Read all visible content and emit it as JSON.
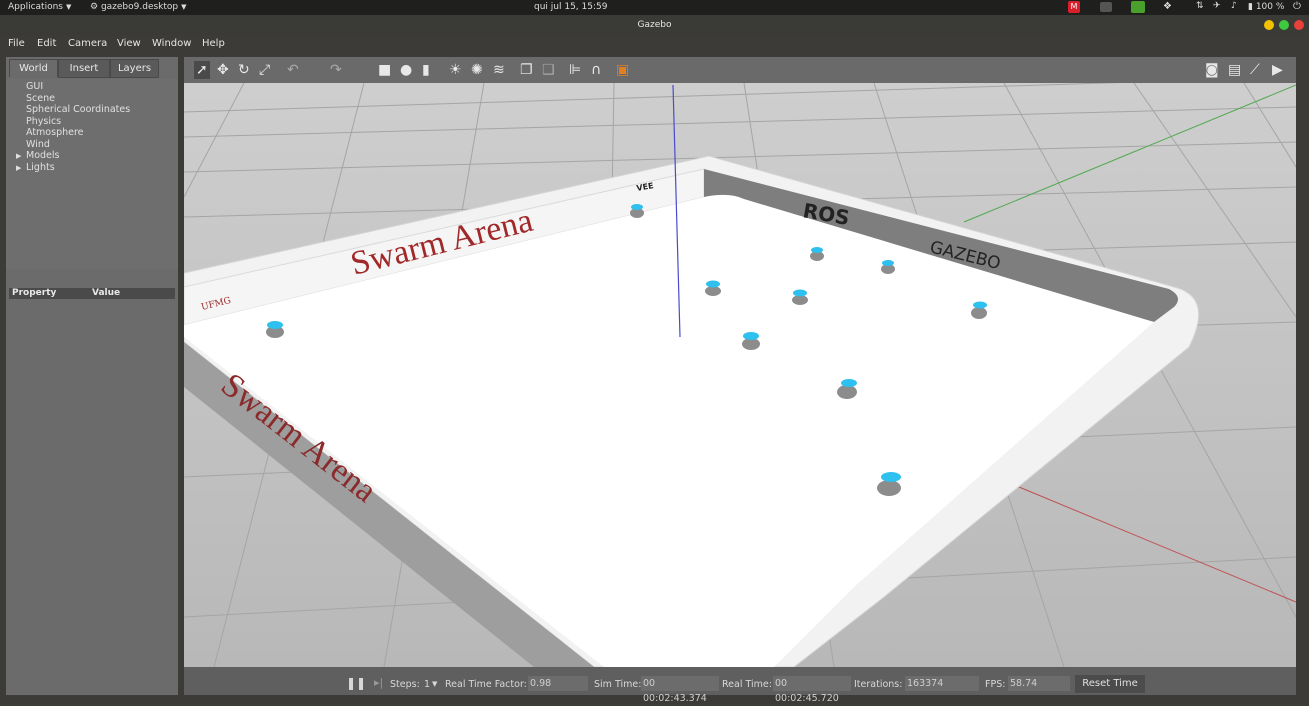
{
  "topbar": {
    "applications": "Applications",
    "app_name": "gazebo9.desktop",
    "datetime": "qui jul 15, 15:59",
    "battery": "100 %",
    "mail_badge": "M"
  },
  "window": {
    "title": "Gazebo"
  },
  "menu": {
    "items": [
      "File",
      "Edit",
      "Camera",
      "View",
      "Window",
      "Help"
    ]
  },
  "left_panel": {
    "tabs": [
      "World",
      "Insert",
      "Layers"
    ],
    "tree": [
      "GUI",
      "Scene",
      "Spherical Coordinates",
      "Physics",
      "Atmosphere",
      "Wind",
      "Models",
      "Lights"
    ],
    "property_header": "Property",
    "value_header": "Value"
  },
  "scene": {
    "arena_label_top": "Swarm Arena",
    "arena_label_side": "Swarm Arena",
    "logo_ros": "ROS",
    "logo_gazebo": "GAZEBO",
    "logo_ufmg": "UFMG",
    "logo_vee": "VEE"
  },
  "bottom_bar": {
    "steps_label": "Steps:",
    "steps_value": "1",
    "rtf_label": "Real Time Factor:",
    "rtf_value": "0.98",
    "sim_time_label": "Sim Time:",
    "sim_time_value": "00 00:02:43.374",
    "real_time_label": "Real Time:",
    "real_time_value": "00 00:02:45.720",
    "iterations_label": "Iterations:",
    "iterations_value": "163374",
    "fps_label": "FPS:",
    "fps_value": "58.74",
    "reset_label": "Reset Time"
  },
  "colors": {
    "panel_bg": "#6b6b6b",
    "floor": "#ffffff",
    "arena_text": "#a02828",
    "robot_top": "#2ec0ee"
  }
}
